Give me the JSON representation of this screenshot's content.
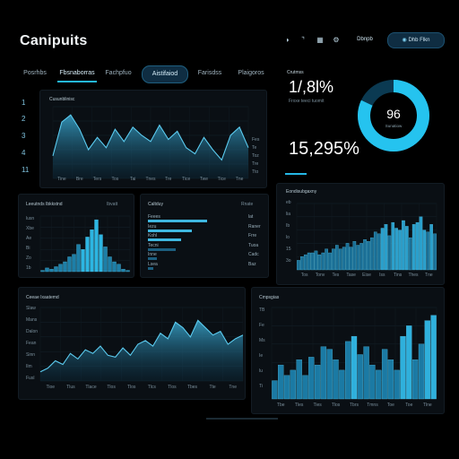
{
  "header": {
    "title": "Canipuits",
    "icons": [
      "shield-icon",
      "moon-icon",
      "grid-icon",
      "settings-icon"
    ],
    "menu_label": "Dbnpb",
    "action_label": "Dhb Flkn"
  },
  "tabs": [
    {
      "label": "Posrhbs"
    },
    {
      "label": "Fbsnaborras"
    },
    {
      "label": "Fachpfuo"
    },
    {
      "label": "Aistifaiod"
    },
    {
      "label": "Farisdss"
    },
    {
      "label": "Plaigoros"
    }
  ],
  "side_numbers": [
    "1",
    "2",
    "3",
    "4",
    "11"
  ],
  "main_chart": {
    "title": "Cusunblinisc",
    "x_labels": [
      "Tine",
      "Bre",
      "Ters",
      "Tos",
      "Tai",
      "Tnes",
      "Tre",
      "Tice",
      "Twe",
      "Tice",
      "Tne"
    ],
    "right_labels": [
      "Fes",
      "Te",
      "Toz",
      "Tre",
      "Tto"
    ]
  },
  "stats": {
    "label": "Crutmss",
    "stat1": "1/,8l%",
    "stat1_sub": "Frxxe teeci tuomit",
    "stat2": "15,295%",
    "donut_value": "96",
    "donut_sub": "Sunatiow",
    "donut_percent": 0.82
  },
  "panel_hist": {
    "title": "Leeutnds Ibkkstnd",
    "tag": "Ibvatt",
    "y_labels": [
      "lusn",
      "Xbe",
      "Ae",
      "Bi",
      "Zo",
      "1b"
    ]
  },
  "panel_hbars": {
    "title": "Caltduy",
    "tag": "Rnate",
    "rows": [
      {
        "label": "Feees",
        "value": "lat"
      },
      {
        "label": "Iezu",
        "value": "Raner"
      },
      {
        "label": "Kohl",
        "value": "Frre"
      },
      {
        "label": "Tecni",
        "value": "Tuoa"
      },
      {
        "label": "Inne",
        "value": "Cadc"
      },
      {
        "label": "Lsea",
        "value": "Baz"
      }
    ]
  },
  "panel_bars_right": {
    "title": "Eondisubgaxny",
    "y_labels": [
      "eb",
      "lia",
      "Ib",
      "lo",
      "15",
      "3o"
    ],
    "x_labels": [
      "Tos",
      "Tonv",
      "Tes",
      "Tase",
      "Eise",
      "Iss",
      "Tins",
      "Thes",
      "Tne"
    ]
  },
  "panel_area_bottom": {
    "title": "Ceeae Ixaatemd",
    "y_labels": [
      "Slaw",
      "Mans",
      "Dalon",
      "Fean",
      "Sinn",
      "Ilm",
      "Fusl"
    ],
    "x_labels": [
      "Tioe",
      "Tlus",
      "Tlace",
      "Tlos",
      "Tlos",
      "Tlcs",
      "Tlos",
      "Tbes",
      "Tte",
      "Tne"
    ]
  },
  "panel_bars_bottom": {
    "title": "Cmpsgias",
    "y_labels": [
      "TB",
      "Fe",
      "Ms",
      "Ie",
      "lu",
      "Ti"
    ],
    "x_labels": [
      "Tbe",
      "Tles",
      "Ties",
      "Tlos",
      "Tbrs",
      "Tmns",
      "Toe",
      "Toe",
      "Tlne"
    ]
  },
  "colors": {
    "accent": "#25b8e6",
    "accent_light": "#45d8ff",
    "bar": "#1f8fbf",
    "background": "#000000"
  },
  "chart_data": [
    {
      "type": "area",
      "x": [
        "Tine",
        "Bre",
        "Ters",
        "Tos",
        "Tai",
        "Tnes",
        "Tre",
        "Tice",
        "Twe",
        "Tice",
        "Tne"
      ],
      "values": [
        22,
        55,
        62,
        48,
        28,
        40,
        30,
        48,
        36,
        50,
        42,
        36,
        52,
        38,
        46,
        30,
        24,
        40,
        28,
        18,
        42,
        50,
        30
      ],
      "ylim": [
        0,
        70
      ]
    },
    {
      "type": "bar",
      "values": [
        1,
        3,
        2,
        4,
        6,
        8,
        12,
        14,
        22,
        18,
        28,
        34,
        42,
        30,
        20,
        12,
        8,
        6,
        2,
        1
      ],
      "ylim": [
        0,
        45
      ]
    },
    {
      "type": "bar",
      "values": [
        32,
        24,
        18,
        15,
        5,
        3
      ],
      "ylim": [
        0,
        35
      ]
    },
    {
      "type": "bar",
      "categories": [
        "Tos",
        "Tonv",
        "Tes",
        "Tase",
        "Eise",
        "Iss",
        "Tins",
        "Thes",
        "Tne"
      ],
      "values": [
        10,
        14,
        16,
        18,
        18,
        20,
        16,
        18,
        22,
        18,
        22,
        26,
        22,
        24,
        28,
        24,
        30,
        26,
        28,
        32,
        30,
        34,
        40,
        38,
        44,
        48,
        36,
        50,
        44,
        42,
        52,
        46,
        34,
        48,
        50,
        56,
        42,
        40,
        48,
        38
      ],
      "ylim": [
        0,
        70
      ]
    },
    {
      "type": "area",
      "x": [
        "Tioe",
        "Tlus",
        "Tlace",
        "Tlos",
        "Tlos",
        "Tlcs",
        "Tlos",
        "Tbes",
        "Tte",
        "Tne"
      ],
      "values": [
        10,
        14,
        22,
        18,
        30,
        24,
        34,
        30,
        38,
        28,
        26,
        36,
        28,
        40,
        44,
        38,
        52,
        46,
        64,
        58,
        48,
        66,
        58,
        50,
        54,
        40,
        46,
        50
      ],
      "ylim": [
        0,
        80
      ]
    },
    {
      "type": "bar",
      "categories": [
        "Tbe",
        "Tles",
        "Ties",
        "Tlos",
        "Tbrs",
        "Tmns",
        "Toe",
        "Toe",
        "Tlne"
      ],
      "values": [
        14,
        26,
        18,
        22,
        30,
        18,
        32,
        26,
        40,
        38,
        30,
        22,
        44,
        48,
        34,
        40,
        26,
        22,
        38,
        30,
        22,
        48,
        56,
        30,
        42,
        60,
        64
      ],
      "ylim": [
        0,
        70
      ]
    }
  ]
}
